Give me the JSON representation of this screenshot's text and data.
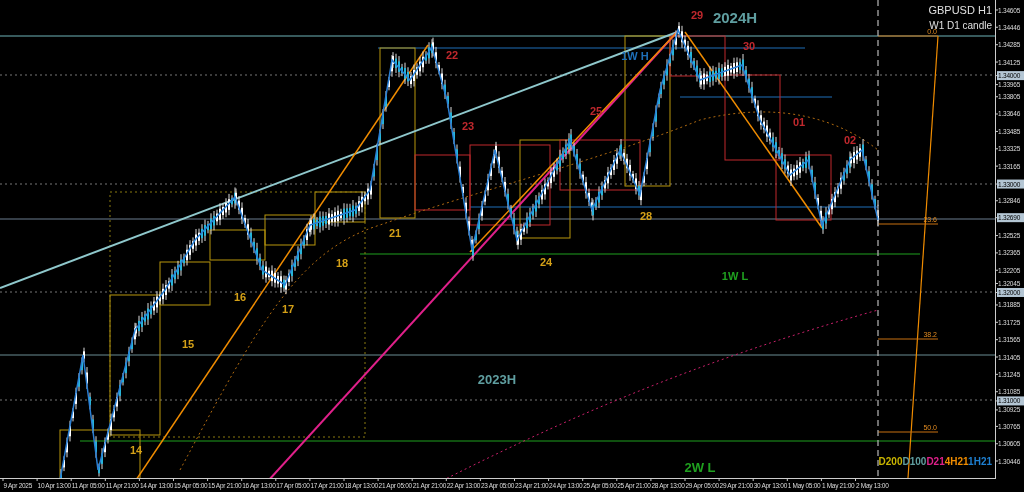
{
  "chart": {
    "title": "GBPUSD H1",
    "subtitle": "W1 D1 candle"
  },
  "price_axis": [
    {
      "text": "1.34605",
      "highlighted": false
    },
    {
      "text": "1.34446",
      "highlighted": false
    },
    {
      "text": "1.34285",
      "highlighted": false
    },
    {
      "text": "1.34125",
      "highlighted": false
    },
    {
      "text": "1.34000",
      "highlighted": true
    },
    {
      "text": "1.33965",
      "highlighted": false
    },
    {
      "text": "1.33805",
      "highlighted": false
    },
    {
      "text": "1.33646",
      "highlighted": false
    },
    {
      "text": "1.33485",
      "highlighted": false
    },
    {
      "text": "1.33325",
      "highlighted": false
    },
    {
      "text": "1.33165",
      "highlighted": false
    },
    {
      "text": "1.33000",
      "highlighted": true
    },
    {
      "text": "1.32846",
      "highlighted": false
    },
    {
      "text": "1.32690",
      "highlighted": true
    },
    {
      "text": "1.32525",
      "highlighted": false
    },
    {
      "text": "1.32365",
      "highlighted": false
    },
    {
      "text": "1.32205",
      "highlighted": false
    },
    {
      "text": "1.32045",
      "highlighted": false
    },
    {
      "text": "1.32000",
      "highlighted": true
    },
    {
      "text": "1.31885",
      "highlighted": false
    },
    {
      "text": "1.31725",
      "highlighted": false
    },
    {
      "text": "1.31565",
      "highlighted": false
    },
    {
      "text": "1.31405",
      "highlighted": false
    },
    {
      "text": "1.31245",
      "highlighted": false
    },
    {
      "text": "1.31085",
      "highlighted": false
    },
    {
      "text": "1.31000",
      "highlighted": true
    },
    {
      "text": "1.30925",
      "highlighted": false
    },
    {
      "text": "1.30765",
      "highlighted": false
    },
    {
      "text": "1.30605",
      "highlighted": false
    },
    {
      "text": "1.30446",
      "highlighted": false
    }
  ],
  "time_axis": [
    "9 Apr 2025",
    "10 Apr 13:00",
    "11 Apr 05:00",
    "11 Apr 21:00",
    "14 Apr 13:00",
    "15 Apr 05:00",
    "15 Apr 21:00",
    "16 Apr 13:00",
    "17 Apr 05:00",
    "17 Apr 21:00",
    "18 Apr 13:00",
    "21 Apr 05:00",
    "21 Apr 21:00",
    "22 Apr 13:00",
    "23 Apr 05:00",
    "23 Apr 21:00",
    "24 Apr 13:00",
    "25 Apr 05:00",
    "25 Apr 21:00",
    "28 Apr 13:00",
    "29 Apr 05:00",
    "29 Apr 21:00",
    "30 Apr 13:00",
    "1 May 05:00",
    "1 May 21:00",
    "2 May 13:00"
  ],
  "annotations": [
    {
      "text": "2024H",
      "color": "#5f9ea0"
    },
    {
      "text": "29",
      "color": "#c0282d"
    },
    {
      "text": "30",
      "color": "#c0282d"
    },
    {
      "text": "22",
      "color": "#c0282d"
    },
    {
      "text": "1W H",
      "color": "#1e6fb8"
    },
    {
      "text": "23",
      "color": "#c0282d"
    },
    {
      "text": "25",
      "color": "#c0282d"
    },
    {
      "text": "01",
      "color": "#c0282d"
    },
    {
      "text": "02",
      "color": "#c0282d"
    },
    {
      "text": "28",
      "color": "#d4a017"
    },
    {
      "text": "21",
      "color": "#d4a017"
    },
    {
      "text": "18",
      "color": "#d4a017"
    },
    {
      "text": "24",
      "color": "#d4a017"
    },
    {
      "text": "16",
      "color": "#d4a017"
    },
    {
      "text": "17",
      "color": "#d4a017"
    },
    {
      "text": "15",
      "color": "#d4a017"
    },
    {
      "text": "14",
      "color": "#d4a017"
    },
    {
      "text": "1W L",
      "color": "#1fa01f"
    },
    {
      "text": "2023H",
      "color": "#5f9ea0"
    },
    {
      "text": "2W L",
      "color": "#1fa01f"
    }
  ],
  "fibonacci_levels": [
    "0.0",
    "23.6",
    "38.2",
    "50.0"
  ],
  "legend": [
    {
      "text": "D200",
      "color": "#c8b400"
    },
    {
      "text": "D100",
      "color": "#5f9ea0"
    },
    {
      "text": "D21",
      "color": "#e0208a"
    },
    {
      "text": "4H21",
      "color": "#f08c00"
    },
    {
      "text": "1H21",
      "color": "#1e7fd0"
    }
  ]
}
